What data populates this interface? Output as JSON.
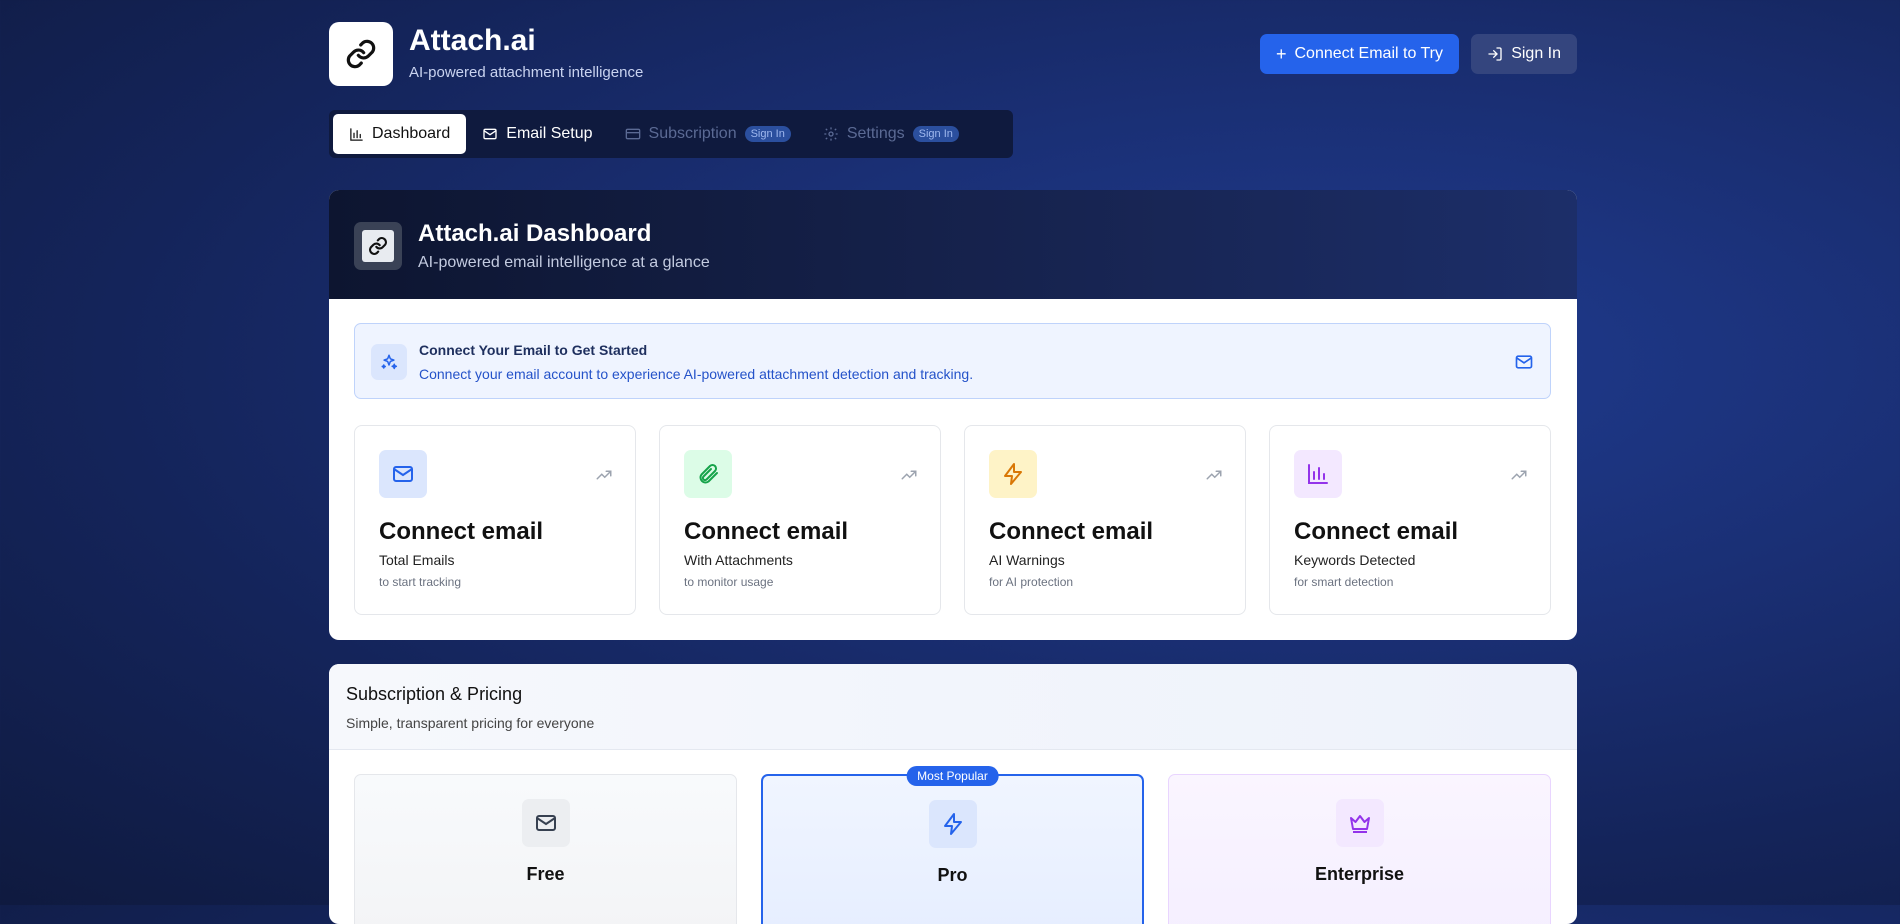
{
  "header": {
    "title": "Attach.ai",
    "subtitle": "AI-powered attachment intelligence",
    "connect_button": "Connect Email to Try",
    "signin_button": "Sign In"
  },
  "tabs": [
    {
      "label": "Dashboard",
      "state": "active",
      "icon": "bar-chart-icon"
    },
    {
      "label": "Email Setup",
      "state": "normal",
      "icon": "mail-icon"
    },
    {
      "label": "Subscription",
      "state": "disabled",
      "icon": "credit-card-icon",
      "badge": "Sign In"
    },
    {
      "label": "Settings",
      "state": "disabled",
      "icon": "gear-icon",
      "badge": "Sign In"
    }
  ],
  "dashboard": {
    "title": "Attach.ai Dashboard",
    "subtitle": "AI-powered email intelligence at a glance",
    "notice": {
      "title": "Connect Your Email to Get Started",
      "text": "Connect your email account to experience AI-powered attachment detection and tracking."
    },
    "stats": [
      {
        "value": "Connect email",
        "label": "Total Emails",
        "hint": "to start tracking",
        "icon": "mail-icon",
        "color": "#2563eb",
        "bg": "#dbe6fd"
      },
      {
        "value": "Connect email",
        "label": "With Attachments",
        "hint": "to monitor usage",
        "icon": "paperclip-icon",
        "color": "#16a34a",
        "bg": "#dcfce7"
      },
      {
        "value": "Connect email",
        "label": "AI Warnings",
        "hint": "for AI protection",
        "icon": "lightning-icon",
        "color": "#d97706",
        "bg": "#fef3c7"
      },
      {
        "value": "Connect email",
        "label": "Keywords Detected",
        "hint": "for smart detection",
        "icon": "bar-chart-icon",
        "color": "#9333ea",
        "bg": "#f3e8ff"
      }
    ]
  },
  "pricing": {
    "title": "Subscription & Pricing",
    "subtitle": "Simple, transparent pricing for everyone",
    "plans": [
      {
        "name": "Free",
        "icon": "mail-icon",
        "color": "#374151",
        "bg": "#f3f4f6"
      },
      {
        "name": "Pro",
        "icon": "lightning-icon",
        "color": "#2563eb",
        "bg": "#dbe6fd",
        "badge": "Most Popular"
      },
      {
        "name": "Enterprise",
        "icon": "crown-icon",
        "color": "#9333ea",
        "bg": "#f3e8ff"
      }
    ]
  }
}
